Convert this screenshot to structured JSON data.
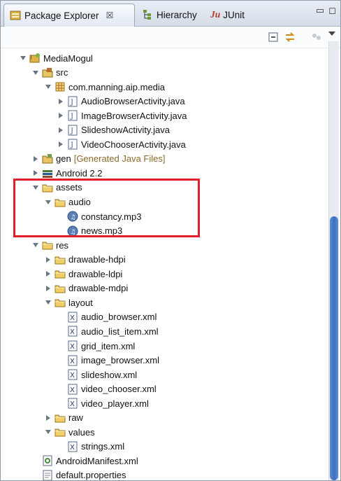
{
  "tabs": [
    {
      "label": "Package Explorer",
      "close": "☒",
      "icon": "package-explorer-icon"
    },
    {
      "label": "Hierarchy",
      "icon": "hierarchy-icon"
    },
    {
      "label": "JUnit",
      "prefix": "Ju",
      "icon": "junit-icon"
    }
  ],
  "window_controls": {
    "minimize": "▭",
    "maximize": "◻"
  },
  "toolbar": {
    "collapse_icon": "collapse-all-icon",
    "link_icon": "link-with-editor-icon",
    "menu_icon": "view-menu-icon"
  },
  "tree": [
    {
      "label": "MediaMogul",
      "icon": "android-project-icon",
      "expanded": true
    },
    {
      "label": "src",
      "icon": "source-folder-icon",
      "expanded": true
    },
    {
      "label": "com.manning.aip.media",
      "icon": "package-icon",
      "expanded": true
    },
    {
      "label": "AudioBrowserActivity.java",
      "icon": "java-file-icon",
      "expanded": false
    },
    {
      "label": "ImageBrowserActivity.java",
      "icon": "java-file-icon",
      "expanded": false
    },
    {
      "label": "SlideshowActivity.java",
      "icon": "java-file-icon",
      "expanded": false
    },
    {
      "label": "VideoChooserActivity.java",
      "icon": "java-file-icon",
      "expanded": false
    },
    {
      "label": "gen",
      "decoration": "[Generated Java Files]",
      "icon": "generated-folder-icon",
      "expanded": false
    },
    {
      "label": "Android 2.2",
      "icon": "library-icon",
      "expanded": false
    },
    {
      "label": "assets",
      "icon": "folder-icon",
      "expanded": true
    },
    {
      "label": "audio",
      "icon": "folder-icon",
      "expanded": true
    },
    {
      "label": "constancy.mp3",
      "icon": "audio-file-icon"
    },
    {
      "label": "news.mp3",
      "icon": "audio-file-icon"
    },
    {
      "label": "res",
      "icon": "folder-icon",
      "expanded": true
    },
    {
      "label": "drawable-hdpi",
      "icon": "folder-icon",
      "expanded": false
    },
    {
      "label": "drawable-ldpi",
      "icon": "folder-icon",
      "expanded": false
    },
    {
      "label": "drawable-mdpi",
      "icon": "folder-icon",
      "expanded": false
    },
    {
      "label": "layout",
      "icon": "folder-icon",
      "expanded": true
    },
    {
      "label": "audio_browser.xml",
      "icon": "xml-file-icon"
    },
    {
      "label": "audio_list_item.xml",
      "icon": "xml-file-icon"
    },
    {
      "label": "grid_item.xml",
      "icon": "xml-file-icon"
    },
    {
      "label": "image_browser.xml",
      "icon": "xml-file-icon"
    },
    {
      "label": "slideshow.xml",
      "icon": "xml-file-icon"
    },
    {
      "label": "video_chooser.xml",
      "icon": "xml-file-icon"
    },
    {
      "label": "video_player.xml",
      "icon": "xml-file-icon"
    },
    {
      "label": "raw",
      "icon": "folder-icon",
      "expanded": false
    },
    {
      "label": "values",
      "icon": "folder-icon",
      "expanded": true
    },
    {
      "label": "strings.xml",
      "icon": "xml-file-icon"
    },
    {
      "label": "AndroidManifest.xml",
      "icon": "manifest-file-icon"
    },
    {
      "label": "default.properties",
      "icon": "properties-file-icon"
    }
  ],
  "colors": {
    "highlight": "#e2202a",
    "scroll_thumb": "#3c6fbf",
    "decoration": "#8a6a2a"
  }
}
